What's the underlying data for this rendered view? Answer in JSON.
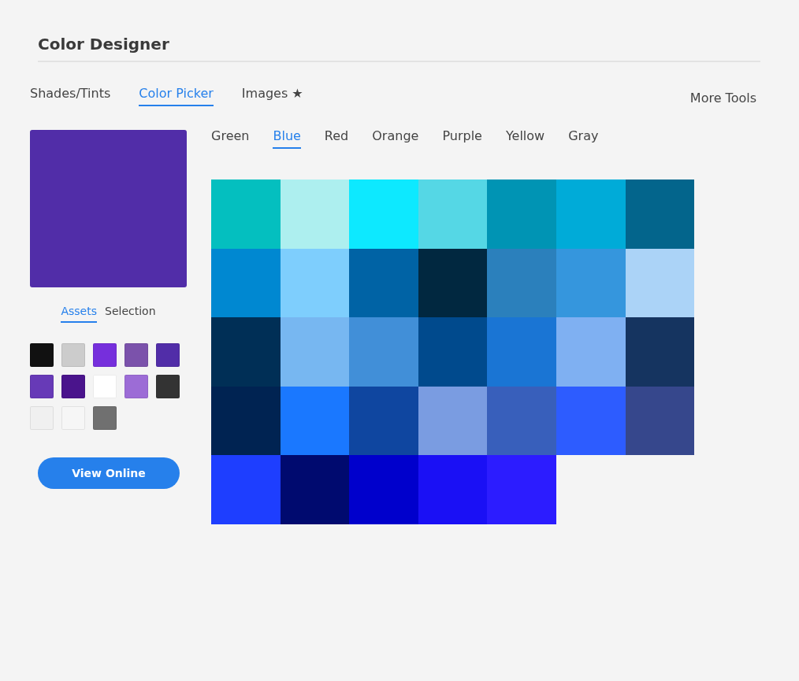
{
  "title": "Color Designer",
  "tabs": [
    {
      "label": "Shades/Tints",
      "selected": false
    },
    {
      "label": "Color Picker",
      "selected": true
    },
    {
      "label": "Images ★",
      "selected": false
    }
  ],
  "more_tools": "More Tools",
  "preview": {
    "color": "#512da8"
  },
  "subtabs": [
    {
      "label": "Assets",
      "selected": true
    },
    {
      "label": "Selection",
      "selected": false
    }
  ],
  "swatches": [
    {
      "color": "#111111"
    },
    {
      "color": "#cccccc"
    },
    {
      "color": "#762fdc"
    },
    {
      "color": "#7b52ab"
    },
    {
      "color": "#512da8"
    },
    {
      "color": "#673ab7"
    },
    {
      "color": "#4a148c"
    },
    {
      "color": "#ffffff"
    },
    {
      "color": "#9c6cd6"
    },
    {
      "color": "#333333"
    },
    {
      "color": "#f0f0f0"
    },
    {
      "color": "#f6f6f6"
    },
    {
      "color": "#707070"
    }
  ],
  "view_online": "View Online",
  "color_tabs": [
    {
      "label": "Green",
      "selected": false
    },
    {
      "label": "Blue",
      "selected": true
    },
    {
      "label": "Red",
      "selected": false
    },
    {
      "label": "Orange",
      "selected": false
    },
    {
      "label": "Purple",
      "selected": false
    },
    {
      "label": "Yellow",
      "selected": false
    },
    {
      "label": "Gray",
      "selected": false
    }
  ],
  "grid": [
    {
      "color": "#04bfbf"
    },
    {
      "color": "#adefef"
    },
    {
      "color": "#0de9ff"
    },
    {
      "color": "#55d7e5"
    },
    {
      "color": "#0094b4"
    },
    {
      "color": "#00abd8"
    },
    {
      "color": "#03658c"
    },
    {
      "color": "#0088d1"
    },
    {
      "color": "#7ecefd"
    },
    {
      "color": "#0063a5"
    },
    {
      "color": "#012840"
    },
    {
      "color": "#2b80bc"
    },
    {
      "color": "#3596dd"
    },
    {
      "color": "#abd3f7"
    },
    {
      "color": "#002f56"
    },
    {
      "color": "#77b7f1"
    },
    {
      "color": "#418fd8"
    },
    {
      "color": "#004a8d"
    },
    {
      "color": "#1a75d4"
    },
    {
      "color": "#7fb0f2"
    },
    {
      "color": "#153460"
    },
    {
      "color": "#002352"
    },
    {
      "color": "#1a78ff"
    },
    {
      "color": "#0f46a0"
    },
    {
      "color": "#7a9ce1"
    },
    {
      "color": "#385fbb"
    },
    {
      "color": "#2d5cff"
    },
    {
      "color": "#36478c"
    },
    {
      "color": "#1e3eff"
    },
    {
      "color": "#000a6f"
    },
    {
      "color": "#0000cc"
    },
    {
      "color": "#1a10f5"
    },
    {
      "color": "#2c1cff"
    }
  ]
}
